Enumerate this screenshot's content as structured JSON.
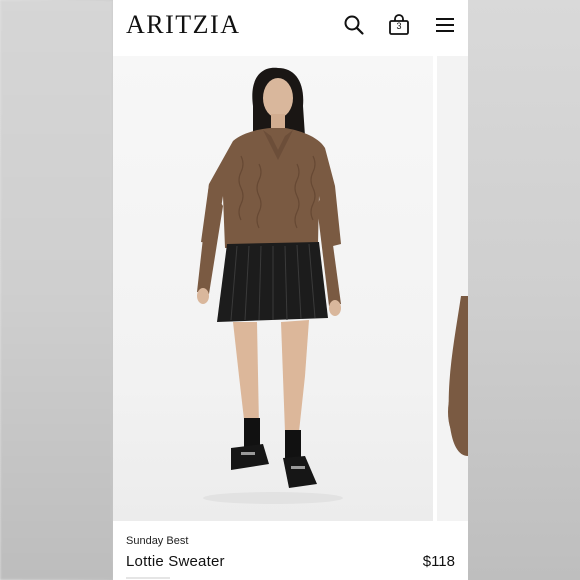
{
  "header": {
    "logo": "ARITZIA",
    "bag_count": "3"
  },
  "icons": {
    "search": "search-icon",
    "bag": "shopping-bag-icon",
    "menu": "hamburger-menu-icon"
  },
  "product": {
    "brand": "Sunday Best",
    "name": "Lottie Sweater",
    "price": "$118"
  },
  "colors": {
    "sweater": "#7a5a42",
    "skirt": "#1c1c1c",
    "background": "#f2f2f2"
  }
}
